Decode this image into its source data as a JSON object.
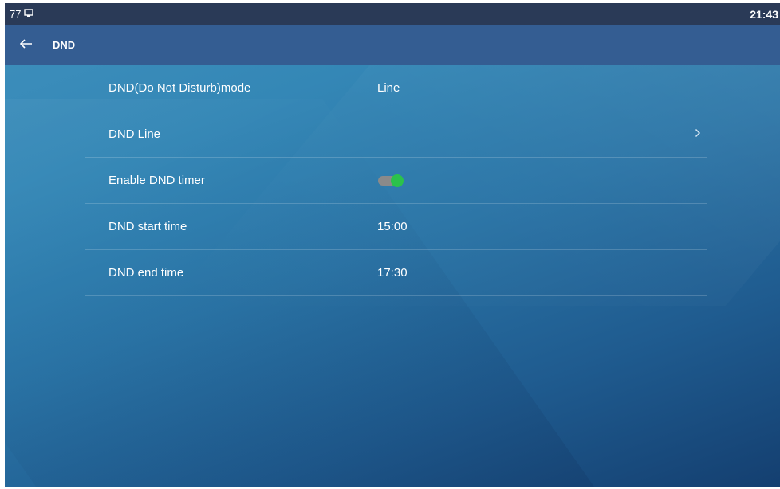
{
  "status_bar": {
    "line_number": "77",
    "time": "21:43"
  },
  "title_bar": {
    "back_icon": "arrow-left-icon",
    "title": "DND"
  },
  "settings": {
    "items": [
      {
        "label": "DND(Do Not Disturb)mode",
        "value": "Line"
      },
      {
        "label": "DND Line",
        "value": "",
        "icon": "chevron-right-icon"
      },
      {
        "label": "Enable DND timer",
        "toggle_on": true
      },
      {
        "label": "DND start time",
        "value": "15:00"
      },
      {
        "label": "DND end time",
        "value": "17:30"
      }
    ]
  },
  "colors": {
    "status_bar_bg": "#2a3a57",
    "title_bar_bg": "#345d92",
    "toggle_on": "#2bc24b"
  }
}
